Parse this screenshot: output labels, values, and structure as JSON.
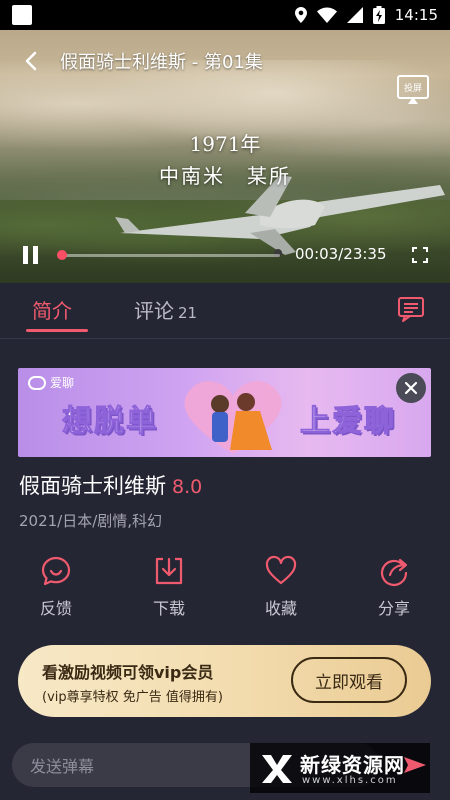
{
  "status_bar": {
    "time": "14:15"
  },
  "player": {
    "title": "假面骑士利维斯 - 第01集",
    "cast_label": "投屏",
    "caption_line1": "1971年",
    "caption_line2": "中南米　某所",
    "current_time": "00:03",
    "total_time": "23:35",
    "time_display": "00:03/23:35",
    "progress_fraction": 0.002
  },
  "tabs": {
    "intro_label": "简介",
    "comments_label": "评论",
    "comments_count": "21"
  },
  "ad": {
    "brand": "爱聊",
    "headline_left": "想脱单",
    "headline_right": "上爱聊"
  },
  "show": {
    "title": "假面骑士利维斯",
    "score": "8.0",
    "meta": "2021/日本/剧情,科幻"
  },
  "actions": [
    {
      "label": "反馈",
      "icon": "feedback-icon"
    },
    {
      "label": "下载",
      "icon": "download-icon"
    },
    {
      "label": "收藏",
      "icon": "heart-icon"
    },
    {
      "label": "分享",
      "icon": "share-icon"
    }
  ],
  "vip_banner": {
    "title": "看激励视频可领vip会员",
    "subtitle": "(vip尊享特权 免广告 值得拥有)",
    "button": "立即观看"
  },
  "danmaku": {
    "placeholder": "发送弹幕"
  },
  "watermark": {
    "brand": "新绿资源网",
    "url": "www.xlhs.com"
  },
  "colors": {
    "accent": "#f05a6e",
    "background": "#252634",
    "vip_gold": "#f3ddb0"
  }
}
